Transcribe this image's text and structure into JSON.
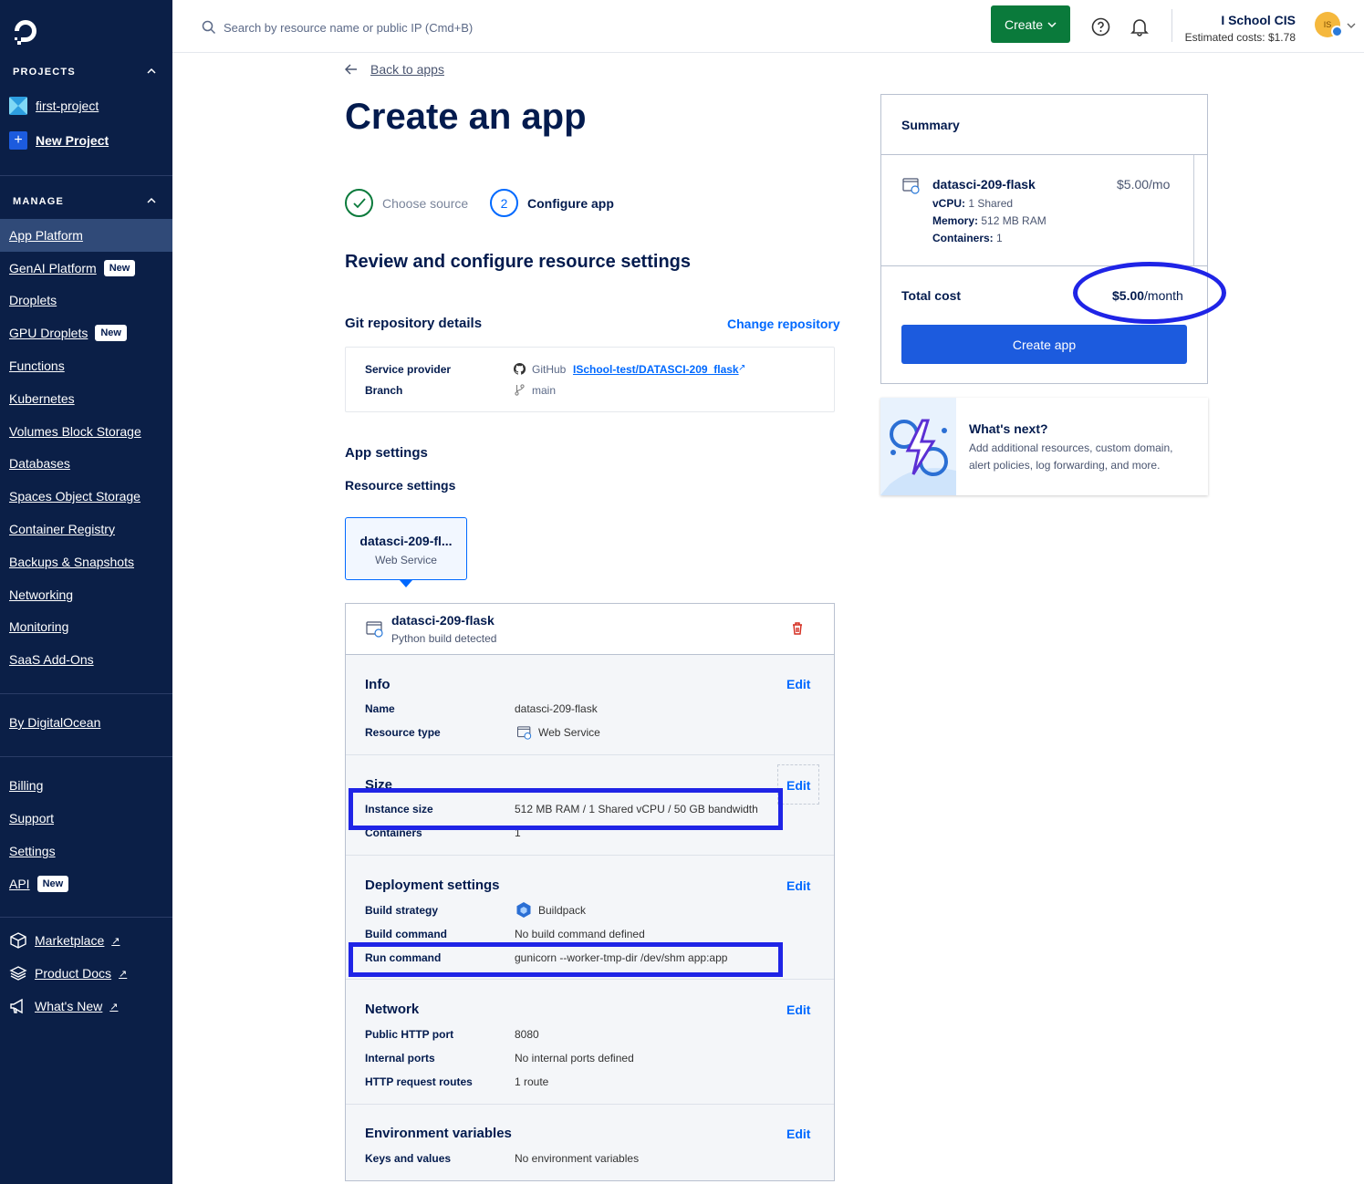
{
  "sidebar": {
    "projects_heading": "PROJECTS",
    "projects": [
      {
        "label": "first-project"
      },
      {
        "label": "New Project"
      }
    ],
    "manage_heading": "MANAGE",
    "nav": [
      {
        "label": "App Platform",
        "active": true
      },
      {
        "label": "GenAI Platform",
        "badge": "New"
      },
      {
        "label": "Droplets"
      },
      {
        "label": "GPU Droplets",
        "badge": "New"
      },
      {
        "label": "Functions"
      },
      {
        "label": "Kubernetes"
      },
      {
        "label": "Volumes Block Storage"
      },
      {
        "label": "Databases"
      },
      {
        "label": "Spaces Object Storage"
      },
      {
        "label": "Container Registry"
      },
      {
        "label": "Backups & Snapshots"
      },
      {
        "label": "Networking"
      },
      {
        "label": "Monitoring"
      },
      {
        "label": "SaaS Add-Ons"
      }
    ],
    "by_do": "By DigitalOcean",
    "account": [
      {
        "label": "Billing"
      },
      {
        "label": "Support"
      },
      {
        "label": "Settings"
      },
      {
        "label": "API",
        "badge": "New"
      }
    ],
    "external": [
      {
        "label": "Marketplace",
        "icon": "marketplace-icon"
      },
      {
        "label": "Product Docs",
        "icon": "docs-icon"
      },
      {
        "label": "What's New",
        "icon": "megaphone-icon"
      }
    ]
  },
  "topbar": {
    "search_placeholder": "Search by resource name or public IP (Cmd+B)",
    "create_label": "Create",
    "team_name": "I School CIS",
    "estimated_costs": "Estimated costs: $1.78",
    "avatar_initials": "IS"
  },
  "main": {
    "back_label": "Back to apps",
    "title": "Create an app",
    "steps": [
      {
        "label": "Choose source",
        "state": "done"
      },
      {
        "number": "2",
        "label": "Configure app",
        "state": "current"
      }
    ],
    "subtitle": "Review and configure resource settings",
    "git": {
      "heading": "Git repository details",
      "change_label": "Change repository",
      "provider_label": "Service provider",
      "provider_name": "GitHub",
      "repo": "ISchool-test/DATASCI-209_flask",
      "branch_label": "Branch",
      "branch": "main"
    },
    "app_settings_heading": "App settings",
    "resource_settings_heading": "Resource settings",
    "component_tab": {
      "name": "datasci-209-fl...",
      "type": "Web Service"
    },
    "component": {
      "name": "datasci-209-flask",
      "detected": "Python build detected",
      "edit_label": "Edit",
      "info": {
        "title": "Info",
        "name_label": "Name",
        "name": "datasci-209-flask",
        "type_label": "Resource type",
        "type": "Web Service"
      },
      "size": {
        "title": "Size",
        "instance_label": "Instance size",
        "instance": "512 MB RAM / 1 Shared vCPU / 50 GB bandwidth",
        "containers_label": "Containers",
        "containers": "1"
      },
      "deploy": {
        "title": "Deployment settings",
        "strategy_label": "Build strategy",
        "strategy": "Buildpack",
        "build_label": "Build command",
        "build": "No build command defined",
        "run_label": "Run command",
        "run": "gunicorn --worker-tmp-dir /dev/shm app:app"
      },
      "network": {
        "title": "Network",
        "port_label": "Public HTTP port",
        "port": "8080",
        "internal_label": "Internal ports",
        "internal": "No internal ports defined",
        "routes_label": "HTTP request routes",
        "routes": "1 route"
      },
      "env": {
        "title": "Environment variables",
        "kv_label": "Keys and values",
        "kv": "No environment variables"
      }
    }
  },
  "summary": {
    "title": "Summary",
    "item_name": "datasci-209-flask",
    "item_price": "$5.00/mo",
    "vcpu_label": "vCPU:",
    "vcpu": "1 Shared",
    "memory_label": "Memory:",
    "memory": "512 MB RAM",
    "containers_label": "Containers:",
    "containers": "1",
    "total_label": "Total cost",
    "total_amount": "$5.00",
    "total_unit": "/month",
    "create_label": "Create app"
  },
  "next": {
    "title": "What's next?",
    "body": "Add additional resources, custom domain, alert policies, log forwarding, and more."
  },
  "colors": {
    "sidebar": "#0b1f47",
    "primary": "#0069ff",
    "create_green": "#0a7a3b",
    "highlight": "#1f24e6"
  }
}
